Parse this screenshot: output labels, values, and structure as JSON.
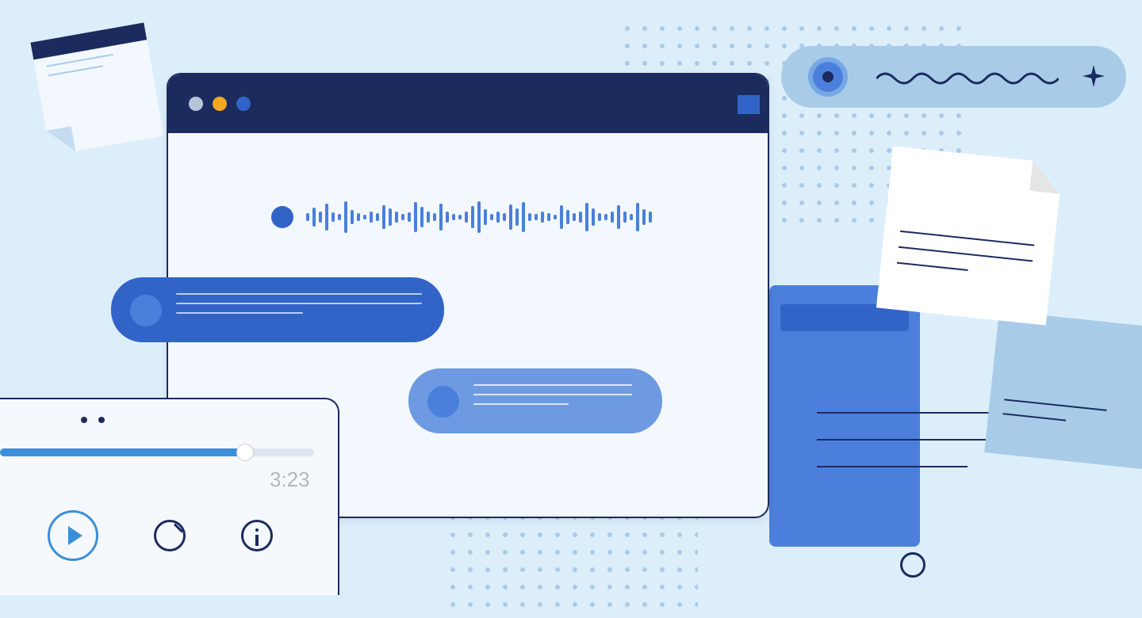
{
  "player": {
    "time_display": "3:23",
    "progress_percent": 78
  },
  "icons": {
    "play": "play-icon",
    "speed": "speed-icon",
    "info": "info-icon",
    "sparkle": "sparkle-icon",
    "record_dot": "record-dot-icon"
  },
  "colors": {
    "background": "#DDEEFB",
    "navy": "#1B2B5E",
    "blue": "#3264C8",
    "light_blue": "#A8CCE8",
    "accent": "#F5A623"
  }
}
